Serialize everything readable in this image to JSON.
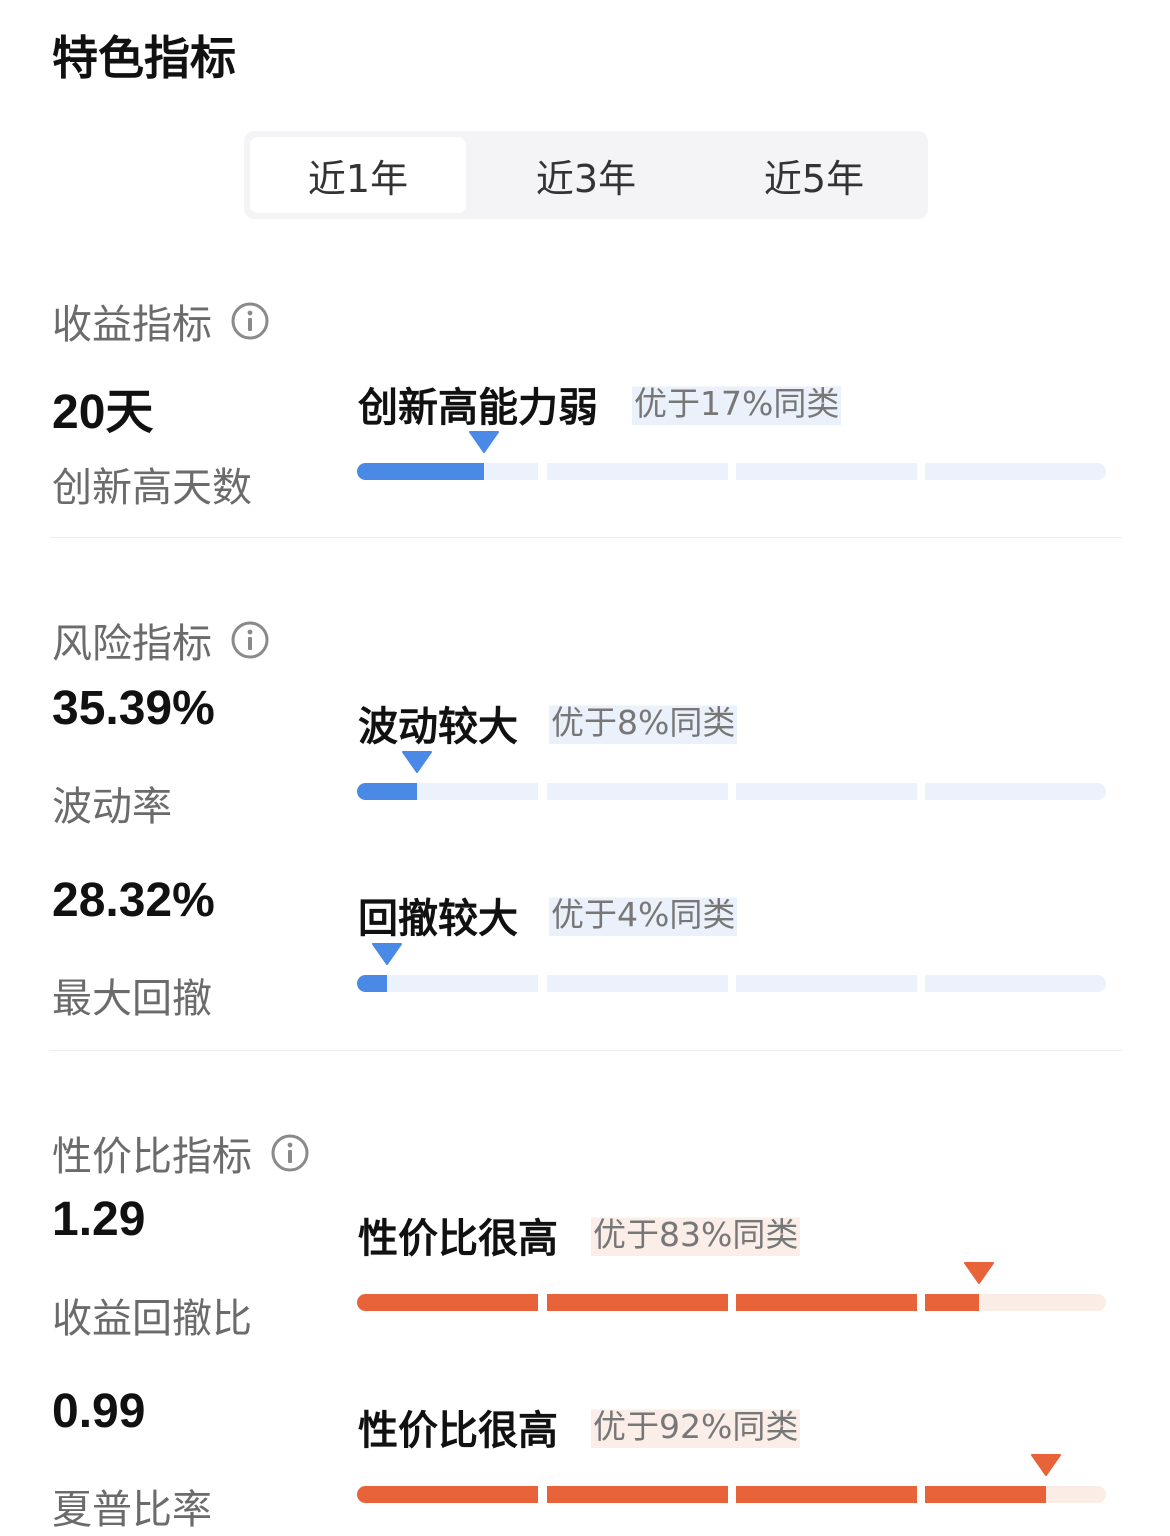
{
  "page_title": "特色指标",
  "tabs": [
    {
      "label": "近1年",
      "active": true
    },
    {
      "label": "近3年",
      "active": false
    },
    {
      "label": "近5年",
      "active": false
    }
  ],
  "colors": {
    "blue": "#4a8ae6",
    "orange": "#e8633a"
  },
  "sections": [
    {
      "title": "收益指标",
      "icon": "info-icon",
      "metrics": [
        {
          "value": "20天",
          "label": "创新高天数",
          "level": "创新高能力弱",
          "better": "优于17%同类",
          "percentile": 0.17,
          "color": "blue"
        }
      ]
    },
    {
      "title": "风险指标",
      "icon": "info-icon",
      "metrics": [
        {
          "value": "35.39%",
          "label": "波动率",
          "level": "波动较大",
          "better": "优于8%同类",
          "percentile": 0.08,
          "color": "blue"
        },
        {
          "value": "28.32%",
          "label": "最大回撤",
          "level": "回撤较大",
          "better": "优于4%同类",
          "percentile": 0.04,
          "color": "blue"
        }
      ]
    },
    {
      "title": "性价比指标",
      "icon": "info-icon",
      "metrics": [
        {
          "value": "1.29",
          "label": "收益回撤比",
          "level": "性价比很高",
          "better": "优于83%同类",
          "percentile": 0.83,
          "color": "orange"
        },
        {
          "value": "0.99",
          "label": "夏普比率",
          "level": "性价比很高",
          "better": "优于92%同类",
          "percentile": 0.92,
          "color": "orange"
        }
      ]
    }
  ]
}
